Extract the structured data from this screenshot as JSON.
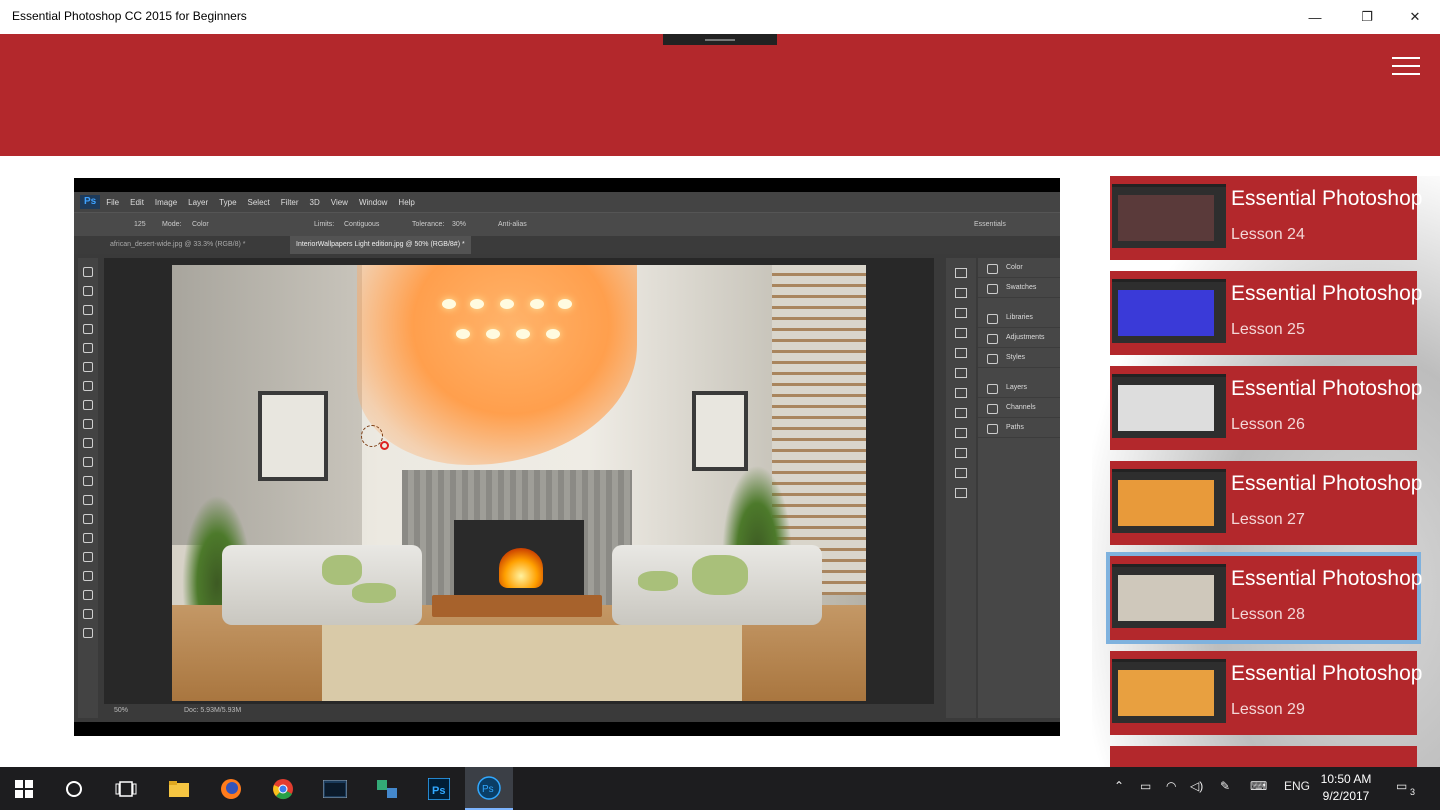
{
  "window": {
    "title": "Essential Photoshop CC 2015 for Beginners",
    "controls": {
      "minimize": "—",
      "restore": "❐",
      "close": "✕"
    }
  },
  "header": {
    "menu_icon": "hamburger-menu-icon",
    "accent_color": "#b3282c"
  },
  "photoshop": {
    "logo": "Ps",
    "menu": [
      "File",
      "Edit",
      "Image",
      "Layer",
      "Type",
      "Select",
      "Filter",
      "3D",
      "View",
      "Window",
      "Help"
    ],
    "options": {
      "mode_label": "Mode:",
      "mode_value": "Color",
      "limits_label": "Limits:",
      "limits_value": "Contiguous",
      "tolerance_label": "Tolerance:",
      "tolerance_value": "30%",
      "antialias": "Anti-alias",
      "workspace": "Essentials",
      "brush_size": "125"
    },
    "tabs": [
      "african_desert-wide.jpg @ 33.3% (RGB/8) *",
      "InteriorWallpapers Light edition.jpg @ 50% (RGB/8#) *"
    ],
    "panels": [
      "Color",
      "Swatches",
      "Libraries",
      "Adjustments",
      "Styles",
      "Layers",
      "Channels",
      "Paths"
    ],
    "status": {
      "zoom": "50%",
      "doc": "Doc: 5.93M/5.93M"
    }
  },
  "lessons": [
    {
      "title": "Essential Photoshop",
      "subtitle": "Lesson 24",
      "thumb_color": "#5a3a3a"
    },
    {
      "title": "Essential Photoshop",
      "subtitle": "Lesson 25",
      "thumb_color": "#3a3ad8"
    },
    {
      "title": "Essential Photoshop",
      "subtitle": "Lesson 26",
      "thumb_color": "#dddddd"
    },
    {
      "title": "Essential Photoshop",
      "subtitle": "Lesson 27",
      "thumb_color": "#e89a3a"
    },
    {
      "title": "Essential Photoshop",
      "subtitle": "Lesson 28",
      "thumb_color": "#cfc8bb",
      "selected": true
    },
    {
      "title": "Essential Photoshop",
      "subtitle": "Lesson 29",
      "thumb_color": "#e8a040"
    }
  ],
  "taskbar": {
    "apps": [
      "windows-start-icon",
      "cortana-search-icon",
      "task-view-icon",
      "file-explorer-icon",
      "firefox-icon",
      "chrome-icon",
      "terminal-icon",
      "network-app-icon",
      "photoshop-icon",
      "photoshop-tutorial-app-icon"
    ],
    "tray": {
      "language": "ENG",
      "time": "10:50 AM",
      "date": "9/2/2017",
      "notifications": "3"
    }
  }
}
